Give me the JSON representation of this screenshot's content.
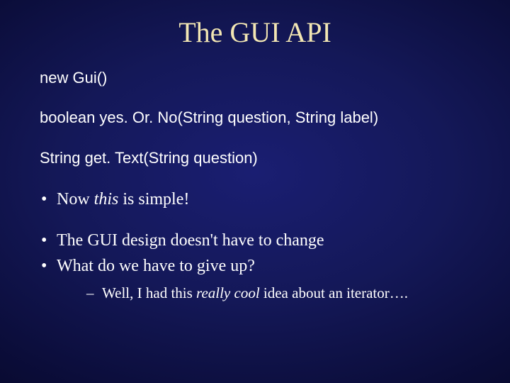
{
  "title": "The GUI API",
  "code": {
    "line1": "new Gui()",
    "line2": "boolean yes. Or. No(String question, String label)",
    "line3": "String get. Text(String question)"
  },
  "bullets": {
    "b1_pre": "Now ",
    "b1_em": "this",
    "b1_post": " is simple!",
    "b2": "The GUI design doesn't have to change",
    "b3": "What do we have to give up?",
    "sub1_pre": "Well, I had this ",
    "sub1_em": "really cool",
    "sub1_post": " idea about an iterator…."
  }
}
